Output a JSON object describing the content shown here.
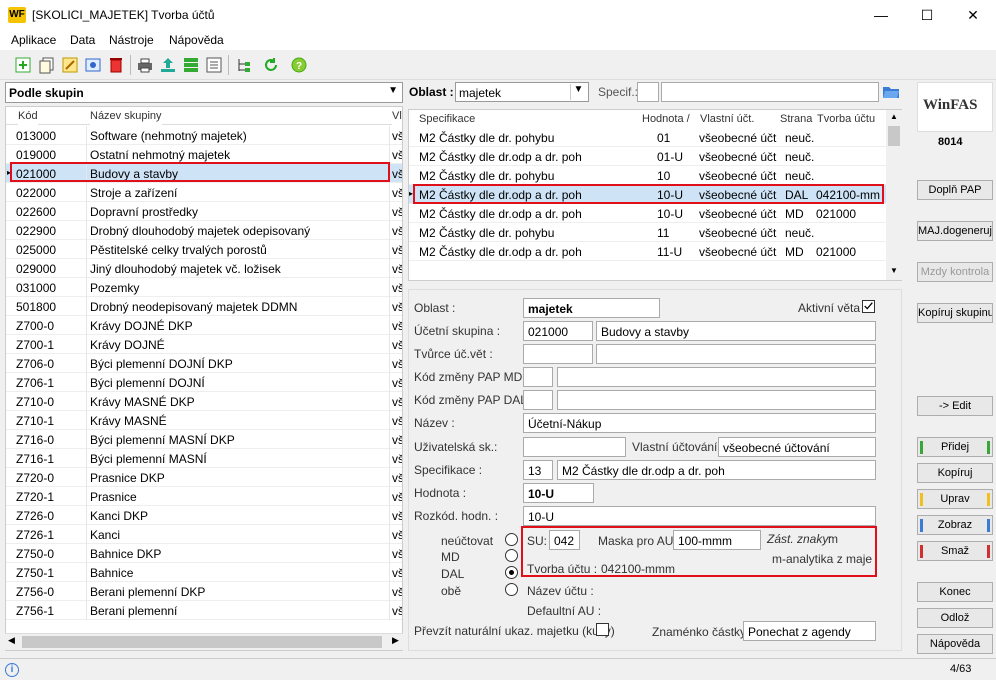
{
  "window": {
    "title": "[SKOLICI_MAJETEK] Tvorba účtů",
    "app_icon": "WF",
    "controls": {
      "minimize": "—",
      "maximize": "☐",
      "close": "✕"
    }
  },
  "menu": [
    "Aplikace",
    "Data",
    "Nástroje",
    "Nápověda"
  ],
  "toolbar_icons": [
    "add-icon",
    "copy-icon",
    "edit-icon",
    "view-icon",
    "delete-icon",
    "print-icon",
    "export-icon",
    "grid-icon",
    "form-icon",
    "tree-icon",
    "refresh-icon",
    "help-icon"
  ],
  "left": {
    "group_selector": "Podle skupin",
    "columns": {
      "code": "Kód",
      "name": "Název skupiny",
      "last": "Vl"
    },
    "rows": [
      {
        "code": "013000",
        "name": "Software (nehmotný majetek)",
        "last": "vš"
      },
      {
        "code": "019000",
        "name": "Ostatní nehmotný majetek",
        "last": "vš"
      },
      {
        "code": "021000",
        "name": "Budovy a stavby",
        "last": "vš"
      },
      {
        "code": "022000",
        "name": "Stroje a zařízení",
        "last": "vš"
      },
      {
        "code": "022600",
        "name": "Dopravní prostředky",
        "last": "vš"
      },
      {
        "code": "022900",
        "name": "Drobný dlouhodobý majetek odepisovaný",
        "last": "vš"
      },
      {
        "code": "025000",
        "name": "Pěstitelské celky trvalých porostů",
        "last": "vš"
      },
      {
        "code": "029000",
        "name": "Jiný dlouhodobý majetek vč. ložisek",
        "last": "vš"
      },
      {
        "code": "031000",
        "name": "Pozemky",
        "last": "vš"
      },
      {
        "code": "501800",
        "name": "Drobný neodepisovaný majetek DDMN",
        "last": "vš"
      },
      {
        "code": "Z700-0",
        "name": "Krávy DOJNÉ DKP",
        "last": "vš"
      },
      {
        "code": "Z700-1",
        "name": "Krávy DOJNÉ",
        "last": "vš"
      },
      {
        "code": "Z706-0",
        "name": "Býci plemenní DOJNÍ DKP",
        "last": "vš"
      },
      {
        "code": "Z706-1",
        "name": "Býci plemenní DOJNÍ",
        "last": "vš"
      },
      {
        "code": "Z710-0",
        "name": "Krávy MASNÉ DKP",
        "last": "vš"
      },
      {
        "code": "Z710-1",
        "name": "Krávy MASNÉ",
        "last": "vš"
      },
      {
        "code": "Z716-0",
        "name": "Býci plemenní MASNÍ DKP",
        "last": "vš"
      },
      {
        "code": "Z716-1",
        "name": "Býci plemenní MASNÍ",
        "last": "vš"
      },
      {
        "code": "Z720-0",
        "name": "Prasnice DKP",
        "last": "vš"
      },
      {
        "code": "Z720-1",
        "name": "Prasnice",
        "last": "vš"
      },
      {
        "code": "Z726-0",
        "name": "Kanci DKP",
        "last": "vš"
      },
      {
        "code": "Z726-1",
        "name": "Kanci",
        "last": "vš"
      },
      {
        "code": "Z750-0",
        "name": "Bahnice DKP",
        "last": "vš"
      },
      {
        "code": "Z750-1",
        "name": "Bahnice",
        "last": "vš"
      },
      {
        "code": "Z756-0",
        "name": "Berani plemenní DKP",
        "last": "vš"
      },
      {
        "code": "Z756-1",
        "name": "Berani plemenní",
        "last": "vš"
      }
    ]
  },
  "filter": {
    "oblast_label": "Oblast :",
    "oblast_value": "majetek",
    "specif_label": "Specif.:",
    "specif_value": ""
  },
  "right_table": {
    "columns": {
      "spec": "Specifikace",
      "value": "Hodnota /",
      "own": "Vlastní účt.",
      "side": "Strana",
      "acct": "Tvorba účtu"
    },
    "rows": [
      {
        "spec": "M2 Částky dle dr. pohybu",
        "value": "01",
        "own": "všeobecné účt",
        "side": "neuč.",
        "acct": ""
      },
      {
        "spec": "M2 Částky dle dr.odp a dr. poh",
        "value": "01-U",
        "own": "všeobecné účt",
        "side": "neuč.",
        "acct": ""
      },
      {
        "spec": "M2 Částky dle dr. pohybu",
        "value": "10",
        "own": "všeobecné účt",
        "side": "neuč.",
        "acct": ""
      },
      {
        "spec": "M2 Částky dle dr.odp a dr. poh",
        "value": "10-U",
        "own": "všeobecné účt",
        "side": "DAL",
        "acct": "042100-mm"
      },
      {
        "spec": "M2 Částky dle dr.odp a dr. poh",
        "value": "10-U",
        "own": "všeobecné účt",
        "side": "MD",
        "acct": "021000"
      },
      {
        "spec": "M2 Částky dle dr. pohybu",
        "value": "11",
        "own": "všeobecné účt",
        "side": "neuč.",
        "acct": ""
      },
      {
        "spec": "M2 Částky dle dr.odp a dr. poh",
        "value": "11-U",
        "own": "všeobecné účt",
        "side": "MD",
        "acct": "021000"
      }
    ]
  },
  "form": {
    "oblast": {
      "label": "Oblast :",
      "value": "majetek"
    },
    "aktivni": {
      "label": "Aktivní věta",
      "checked": true
    },
    "ucetni_skupina": {
      "label": "Účetní skupina :",
      "code": "021000",
      "name": "Budovy a stavby"
    },
    "tvurce": {
      "label": "Tvůrce úč.vět :",
      "code": "",
      "name": ""
    },
    "kod_md": {
      "label": "Kód změny PAP MD :",
      "code": "",
      "name": ""
    },
    "kod_dal": {
      "label": "Kód změny PAP DAL :",
      "code": "",
      "name": ""
    },
    "nazev": {
      "label": "Název :",
      "value": "Účetní-Nákup"
    },
    "uzivatelska": {
      "label": "Uživatelská sk.:",
      "value": ""
    },
    "vlastni": {
      "label": "Vlastní účtování :",
      "value": "všeobecné účtování"
    },
    "specifikace": {
      "label": "Specifikace :",
      "code": "13",
      "name": "M2 Částky dle dr.odp a dr. poh"
    },
    "hodnota": {
      "label": "Hodnota :",
      "value": "10-U"
    },
    "rozkod": {
      "label": "Rozkód. hodn. :",
      "value": "10-U"
    },
    "radios": [
      {
        "label": "neúčtovat",
        "checked": false
      },
      {
        "label": "MD",
        "checked": false
      },
      {
        "label": "DAL",
        "checked": true
      },
      {
        "label": "obě",
        "checked": false
      }
    ],
    "su": {
      "label": "SU:",
      "value": "042"
    },
    "maska": {
      "label": "Maska pro AU:",
      "value": "100-mmm"
    },
    "zast": {
      "label": "Zást. znaky:",
      "value": "m",
      "desc": "m-analytika z maje"
    },
    "tvorba": {
      "label": "Tvorba účtu :",
      "value": "042100-mmm"
    },
    "nazev_uctu": {
      "label": "Název účtu :"
    },
    "defaultni": {
      "label": "Defaultní AU :"
    },
    "prevzit": {
      "label": "Převzít naturální ukaz. majetku (kusy)",
      "checked": false
    },
    "znamenko": {
      "label": "Znaménko částky:",
      "value": "Ponechat z agendy"
    }
  },
  "side": {
    "logo": "WinFAS",
    "number": "8014",
    "buttons": {
      "dopln": "Doplň PAP",
      "maj": "MAJ.dogeneruj",
      "mzdy": "Mzdy kontrola",
      "kopiruj_skup": "Kopíruj skupinu",
      "edit": "-> Edit",
      "pridej": "Přidej",
      "kopiruj": "Kopíruj",
      "uprav": "Uprav",
      "zobraz": "Zobraz",
      "smaz": "Smaž",
      "konec": "Konec",
      "odloz": "Odlož",
      "napoveda": "Nápověda"
    },
    "colors": {
      "green": "#3aa63a",
      "yellow": "#f0c020",
      "blue": "#3a7bd5",
      "red": "#d03030"
    }
  },
  "status": {
    "count": "4/63"
  }
}
